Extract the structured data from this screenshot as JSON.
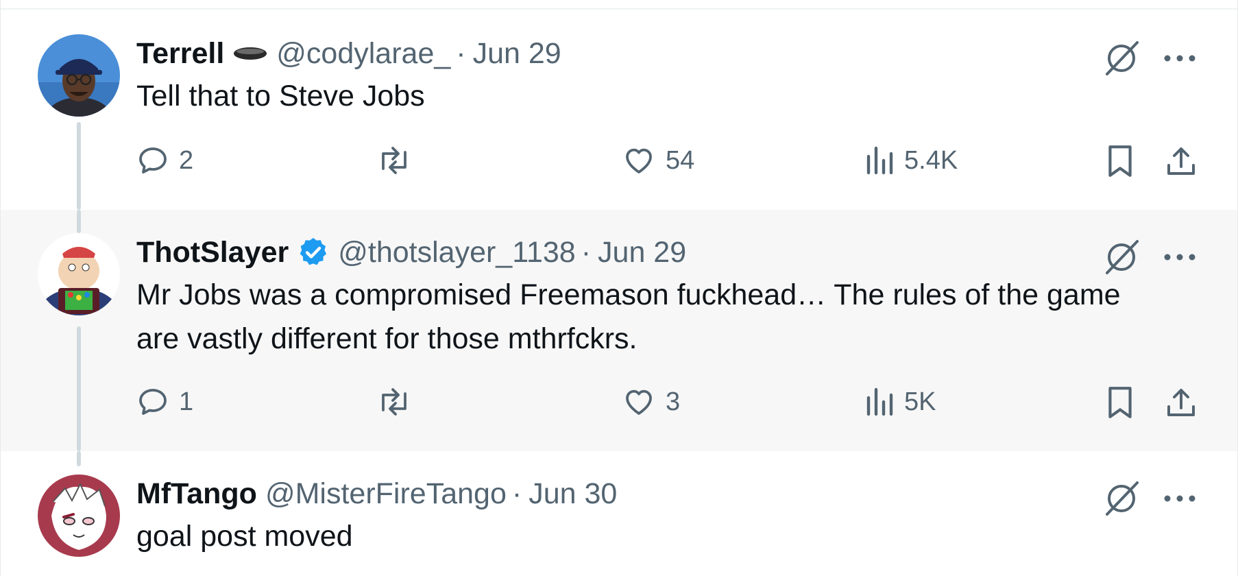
{
  "tweets": [
    {
      "display_name": "Terrell",
      "name_badge_icon": "black-oval-icon",
      "handle": "@codylarae_",
      "separator": "·",
      "date": "Jun 29",
      "text": "Tell that to Steve Jobs",
      "replies": "2",
      "retweets": "",
      "likes": "54",
      "views": "5.4K"
    },
    {
      "display_name": "ThotSlayer",
      "name_badge_icon": "verified-badge-icon",
      "handle": "@thotslayer_1138",
      "separator": "·",
      "date": "Jun 29",
      "text_line1": "Mr Jobs was a compromised Freemason fuckhead… The rules of the game",
      "text_line2": "are vastly different for those mthrfckrs.",
      "replies": "1",
      "retweets": "",
      "likes": "3",
      "views": "5K"
    },
    {
      "display_name": "MfTango",
      "handle": "@MisterFireTango",
      "separator": "·",
      "date": "Jun 30",
      "text": "goal post moved"
    }
  ],
  "colors": {
    "text_primary": "#0f1419",
    "text_secondary": "#536471",
    "verified_blue": "#1d9bf0",
    "thread_line": "#cfd9de",
    "highlight_bg": "#f7f7f7"
  }
}
